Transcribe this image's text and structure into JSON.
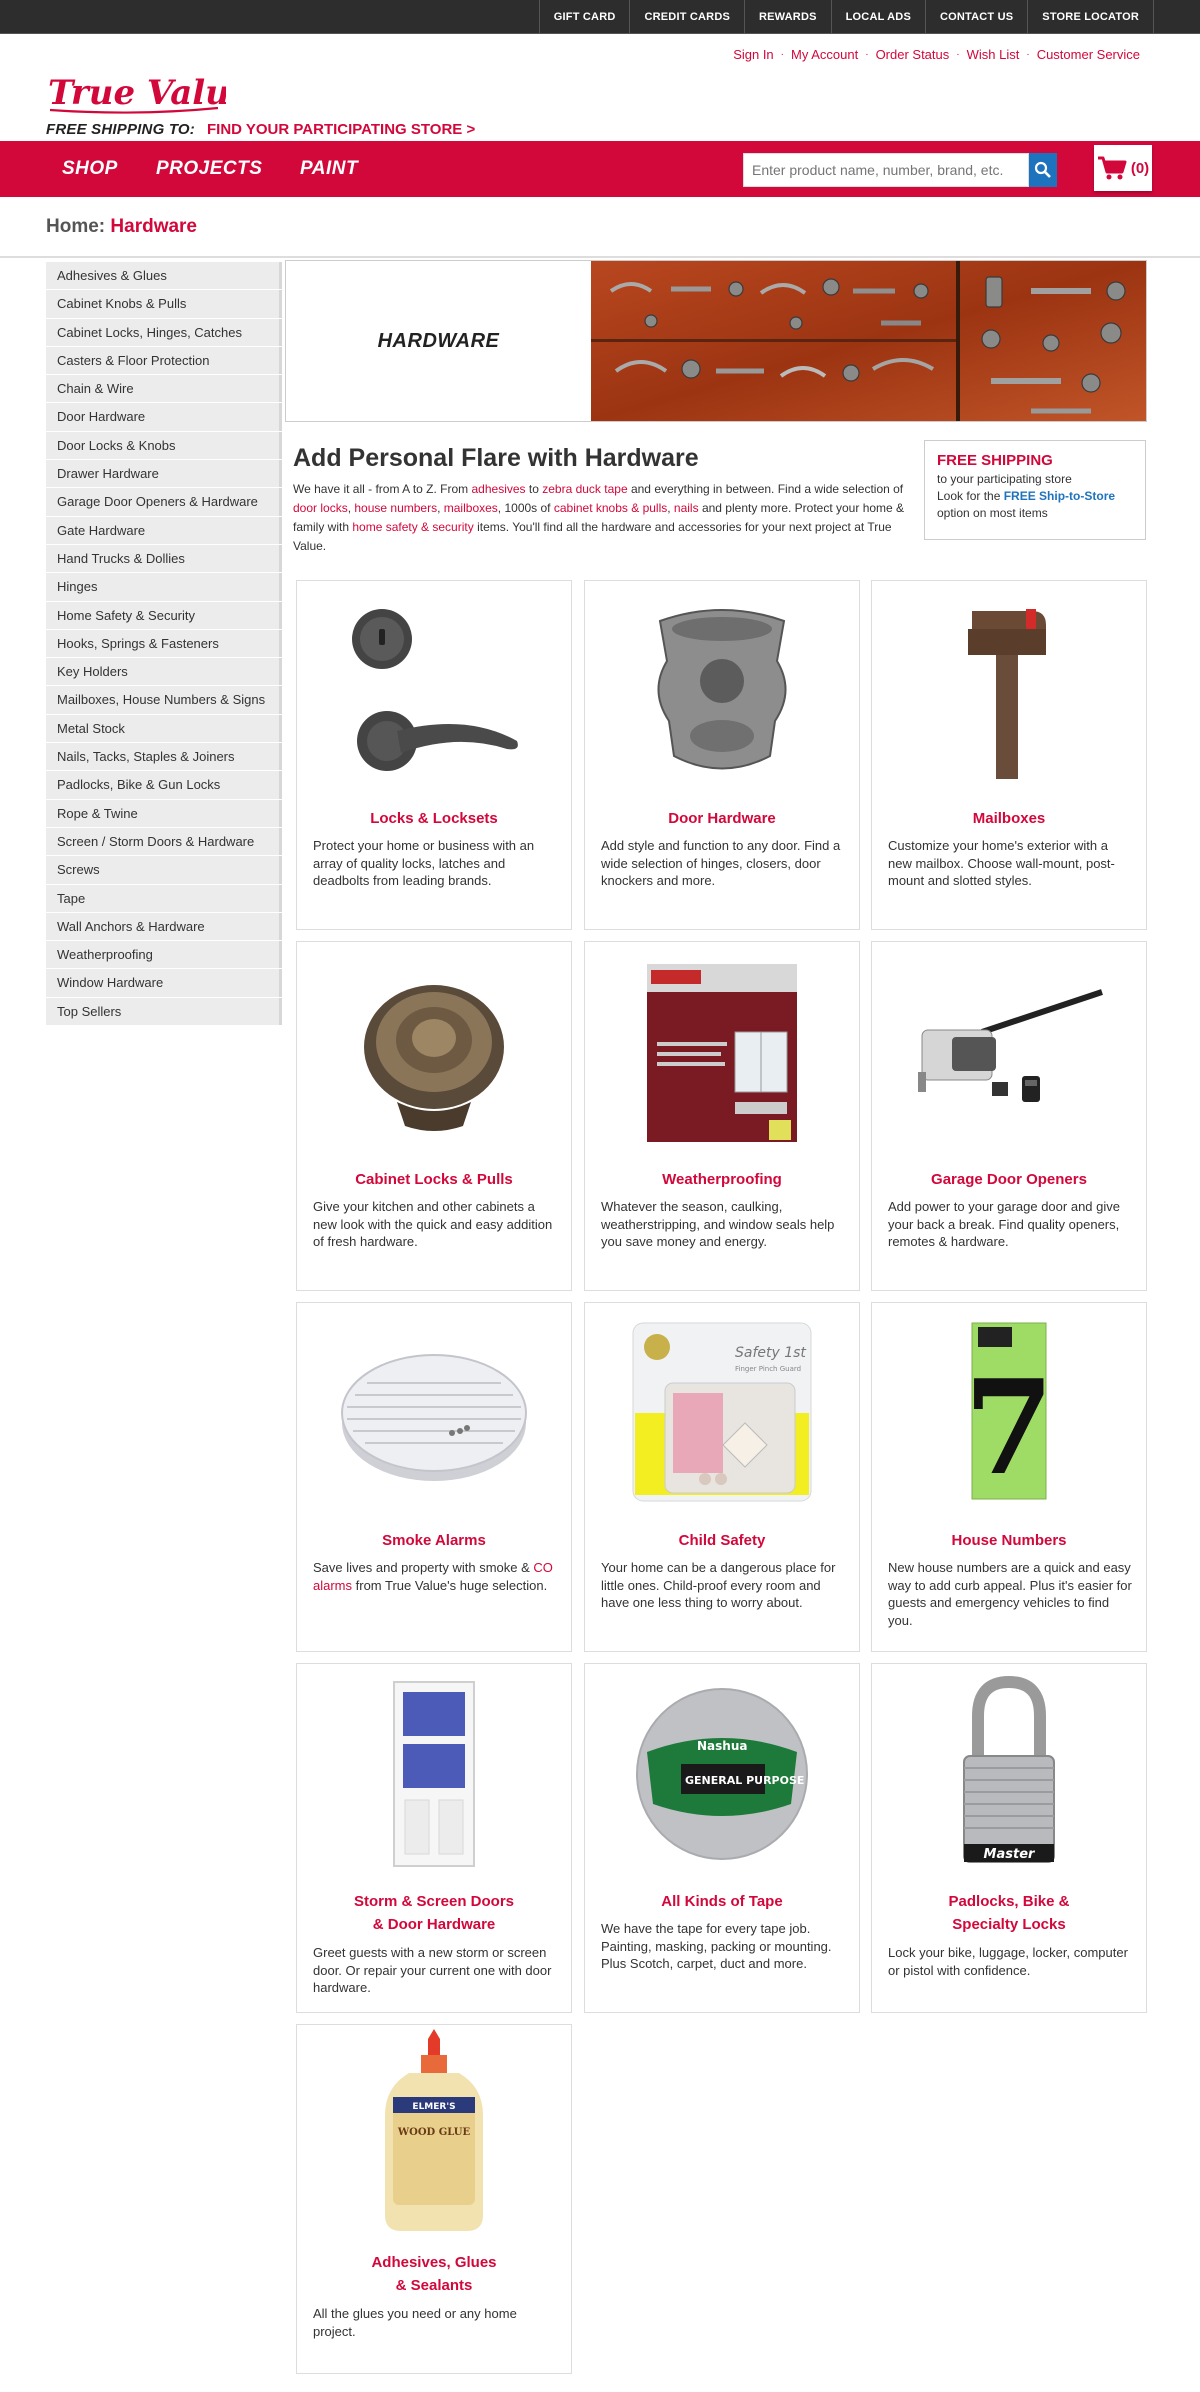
{
  "topbar": {
    "links": [
      "GIFT CARD",
      "CREDIT CARDS",
      "REWARDS",
      "LOCAL ADS",
      "CONTACT US",
      "STORE LOCATOR"
    ]
  },
  "account_links": [
    "Sign In",
    "My Account",
    "Order Status",
    "Wish List",
    "Customer Service"
  ],
  "logo_text": "True Value",
  "shipping": {
    "label": "FREE SHIPPING TO:",
    "link": "FIND YOUR PARTICIPATING STORE >"
  },
  "nav": {
    "items": [
      "SHOP",
      "PROJECTS",
      "PAINT"
    ],
    "search_placeholder": "Enter product name, number, brand, etc.",
    "cart_count": "(0)"
  },
  "breadcrumb": {
    "home": "Home",
    "separator": ": ",
    "current": "Hardware"
  },
  "sidebar": {
    "items": [
      "Adhesives & Glues",
      "Cabinet Knobs & Pulls",
      "Cabinet Locks, Hinges, Catches",
      "Casters & Floor Protection",
      "Chain & Wire",
      "Door Hardware",
      "Door Locks & Knobs",
      "Drawer Hardware",
      "Garage Door Openers & Hardware",
      "Gate Hardware",
      "Hand Trucks & Dollies",
      "Hinges",
      "Home Safety & Security",
      "Hooks, Springs & Fasteners",
      "Key Holders",
      "Mailboxes, House Numbers & Signs",
      "Metal Stock",
      "Nails, Tacks, Staples & Joiners",
      "Padlocks, Bike & Gun Locks",
      "Rope & Twine",
      "Screen / Storm Doors & Hardware",
      "Screws",
      "Tape",
      "Wall Anchors & Hardware",
      "Weatherproofing",
      "Window Hardware",
      "Top Sellers"
    ]
  },
  "hero": {
    "label": "HARDWARE"
  },
  "intro": {
    "title": "Add Personal Flare with Hardware",
    "t1": "We have it all - from A to Z. From ",
    "l1": "adhesives",
    "t2": " to ",
    "l2": "zebra duck tape",
    "t3": " and everything in between. Find a wide selection of ",
    "l3": "door locks",
    "t4": ", ",
    "l4": "house numbers",
    "t5": ", ",
    "l5": "mailboxes",
    "t6": ", 1000s of ",
    "l6": "cabinet knobs & pulls",
    "t7": ", ",
    "l7": "nails",
    "t8": " and plenty more. Protect your home & family with ",
    "l8": "home safety & security",
    "t9": " items. You'll find all the hardware and accessories for your next project at True Value."
  },
  "ship_box": {
    "title": "FREE SHIPPING",
    "line1": "to your participating store",
    "line2_a": "Look for the ",
    "line2_b": "FREE Ship-to-Store",
    "line3": "option on most items"
  },
  "categories": [
    {
      "title": "Locks & Locksets",
      "desc": "Protect your home or business with an array of quality locks, latches and deadbolts from leading brands.",
      "icon": "lockset-icon"
    },
    {
      "title": "Door Hardware",
      "desc": "Add style and function to any door. Find a wide selection of hinges, closers, door knockers and more.",
      "icon": "door-knocker-icon"
    },
    {
      "title": "Mailboxes",
      "desc": "Customize your home's exterior with a new mailbox. Choose wall-mount, post-mount and slotted styles.",
      "icon": "mailbox-icon"
    },
    {
      "title": "Cabinet Locks & Pulls",
      "desc": "Give your kitchen and other cabinets a new look with the quick and easy addition of fresh hardware.",
      "icon": "cabinet-knob-icon"
    },
    {
      "title": "Weatherproofing",
      "desc": "Whatever the season, caulking, weatherstripping, and window seals help you save money and energy.",
      "icon": "insulation-kit-icon"
    },
    {
      "title": "Garage Door Openers",
      "desc": "Add power to your garage door and give your back a break. Find quality openers, remotes & hardware.",
      "icon": "garage-opener-icon"
    },
    {
      "title": "Smoke Alarms",
      "desc_a": "Save lives and property with smoke & ",
      "desc_link": "CO alarms",
      "desc_b": " from True Value's huge selection.",
      "icon": "smoke-alarm-icon"
    },
    {
      "title": "Child Safety",
      "desc": "Your home can be a dangerous place for little ones. Child-proof every room and have one less thing to worry about.",
      "icon": "child-safety-icon",
      "pkg_text": "Safety 1st",
      "pkg_sub": "Finger Pinch Guard"
    },
    {
      "title": "House Numbers",
      "desc": "New house numbers are a quick and easy way to add curb appeal. Plus it's easier for guests and emergency vehicles to find you.",
      "icon": "house-number-icon",
      "digit": "7"
    },
    {
      "title": "Storm & Screen Doors",
      "title2": "& Door Hardware",
      "desc": "Greet guests with a new storm or screen door. Or repair your current one with door hardware.",
      "icon": "storm-door-icon"
    },
    {
      "title": "All Kinds of Tape",
      "desc": "We have the tape for every tape job. Painting, masking, packing or mounting. Plus Scotch, carpet, duct and more.",
      "icon": "duct-tape-icon",
      "tape_brand": "Nashua",
      "tape_label": "GENERAL PURPOSE"
    },
    {
      "title": "Padlocks, Bike &",
      "title2": "Specialty Locks",
      "desc": "Lock your bike, luggage, locker, computer or pistol with confidence.",
      "icon": "padlock-icon",
      "lock_brand": "Master"
    },
    {
      "title": "Adhesives, Glues",
      "title2": "& Sealants",
      "desc": "All the glues you need or any home project.",
      "icon": "wood-glue-icon",
      "glue_brand": "ELMER'S",
      "glue_label": "WOOD GLUE"
    }
  ],
  "colors": {
    "brand_red": "#d2083b",
    "topbar": "#2d2d2d",
    "link_blue": "#1e73be",
    "sidebar_bg": "#ececec"
  }
}
